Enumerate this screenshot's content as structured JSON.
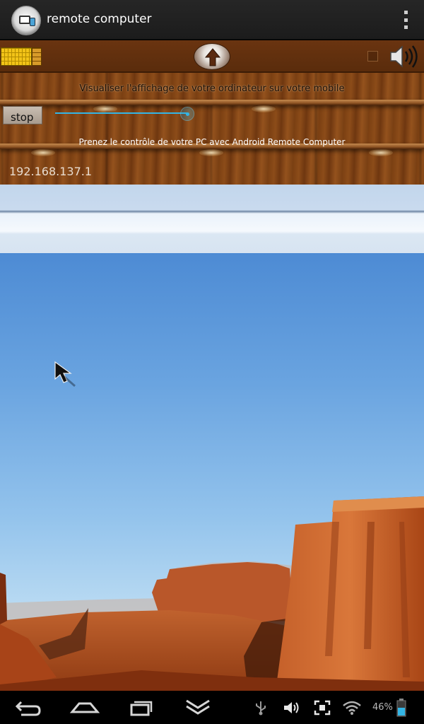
{
  "action_bar": {
    "title": "remote computer",
    "app_icon": "remote-computer-app-icon",
    "overflow_icon": "overflow-menu-icon"
  },
  "wood_panel": {
    "toolbar": {
      "keyboard_icon": "keyboard-icon",
      "upload_icon": "arrow-up-icon",
      "speaker_icon": "speaker-icon",
      "checkbox_checked": false
    },
    "subtitle_top": "Visualiser l'affichage de votre ordinateur sur votre mobile",
    "stop_label": "stop",
    "slider": {
      "value_fraction": 0.95
    },
    "subtitle_bottom": "Prenez le contrôle de votre PC avec Android Remote Computer",
    "ip_address": "192.168.137.1"
  },
  "nav_bar": {
    "back_icon": "back-icon",
    "home_icon": "home-icon",
    "recents_icon": "recent-apps-icon",
    "hide_keyboard_icon": "chevron-down-icon",
    "status": {
      "usb_icon": "usb-icon",
      "volume_icon": "volume-icon",
      "screenshot_icon": "screenshot-icon",
      "wifi_icon": "wifi-icon",
      "battery_percent": "46%",
      "battery_icon": "battery-icon"
    }
  },
  "colors": {
    "action_bar_bg": "#1c1c1c",
    "wood": "#7c4215",
    "accent_blue": "#33b5e5",
    "sky": "#6aa4e0",
    "rock": "#b5501f"
  }
}
